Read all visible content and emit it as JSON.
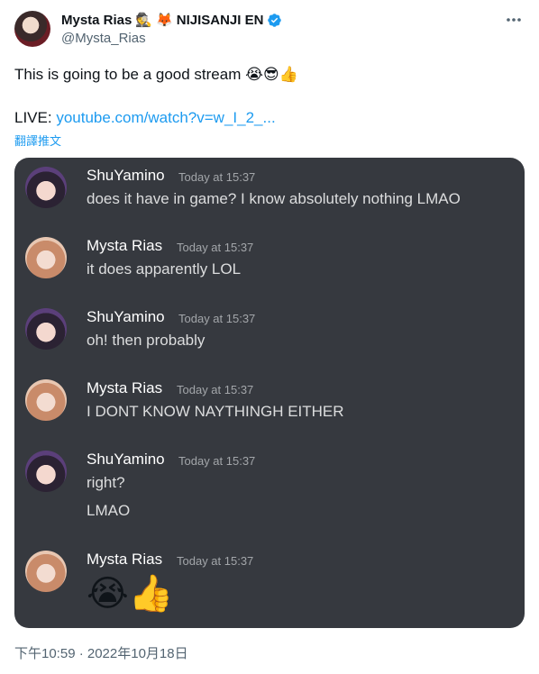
{
  "header": {
    "name": "Mysta Rias",
    "name_suffix": "NIJISANJI EN",
    "handle": "@Mysta_Rias",
    "emojis": [
      "🕵️",
      "🦊"
    ]
  },
  "tweet": {
    "text": "This is going to be a good stream 😭😎👍",
    "live_label": "LIVE:",
    "link_text": "youtube.com/watch?v=w_I_2_...",
    "translate_label": "翻譯推文"
  },
  "discord": {
    "messages": [
      {
        "user": "ShuYamino",
        "time": "Today at 15:37",
        "lines": [
          "does it have in game? I know absolutely nothing LMAO"
        ]
      },
      {
        "user": "Mysta Rias",
        "time": "Today at 15:37",
        "lines": [
          "it does apparently LOL"
        ]
      },
      {
        "user": "ShuYamino",
        "time": "Today at 15:37",
        "lines": [
          "oh! then probably"
        ]
      },
      {
        "user": "Mysta Rias",
        "time": "Today at 15:37",
        "lines": [
          "I DONT KNOW NAYTHINGH EITHER"
        ]
      },
      {
        "user": "ShuYamino",
        "time": "Today at 15:37",
        "lines": [
          "right?",
          "LMAO"
        ]
      },
      {
        "user": "Mysta Rias",
        "time": "Today at 15:37",
        "lines": [
          "😭👍"
        ]
      }
    ]
  },
  "footer": {
    "timestamp": "下午10:59 · 2022年10月18日"
  },
  "colors": {
    "link": "#1d9bf0",
    "discord_bg": "#36393f",
    "verified": "#1d9bf0"
  }
}
